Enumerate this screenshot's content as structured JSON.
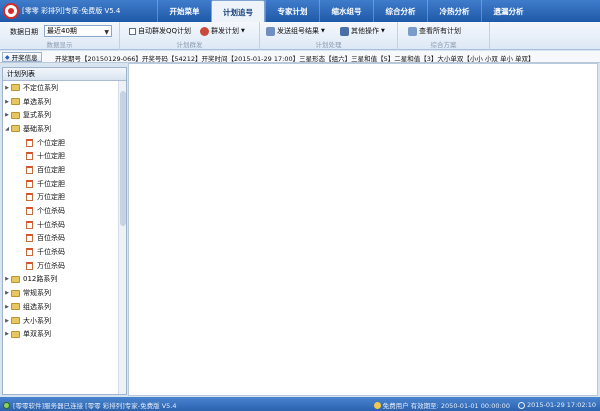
{
  "app": {
    "title": "[零零 彩排列]专家-免费版 V5.4"
  },
  "tabs": [
    {
      "label": "开始菜单",
      "active": false
    },
    {
      "label": "计划追号",
      "active": true
    },
    {
      "label": "专家计划",
      "active": false
    },
    {
      "label": "缩水组号",
      "active": false
    },
    {
      "label": "综合分析",
      "active": false
    },
    {
      "label": "冷热分析",
      "active": false
    },
    {
      "label": "遗漏分析",
      "active": false
    }
  ],
  "ribbon": {
    "data_label": "数据日期",
    "data_select_value": "最近40期",
    "group1_label": "数据显示",
    "auto_qq_label": "自动群发QQ计划",
    "qun_plan_label": "群发计划",
    "group2_label": "计划群发",
    "send_result_label": "发送组号结果",
    "other_ops_label": "其他操作",
    "group3_label": "计划处理",
    "view_all_label": "查看所有计划",
    "group4_label": "综合方案"
  },
  "infobar": {
    "button_label": "开奖信息",
    "text": "开奖期号【20150129-066】开奖号码【54212】开奖时间【2015-01-29 17:00】三星形态【组六】三星和值【5】二星和值【3】大小单双【小小 小双 单小 单双】"
  },
  "left_panel": {
    "title": "计划列表",
    "tree": [
      {
        "label": "不定位系列",
        "type": "folder",
        "expanded": false
      },
      {
        "label": "单选系列",
        "type": "folder",
        "expanded": false
      },
      {
        "label": "复式系列",
        "type": "folder",
        "expanded": false
      },
      {
        "label": "基础系列",
        "type": "folder",
        "expanded": true
      },
      {
        "label": "个位定胆",
        "type": "leaf"
      },
      {
        "label": "十位定胆",
        "type": "leaf"
      },
      {
        "label": "百位定胆",
        "type": "leaf"
      },
      {
        "label": "千位定胆",
        "type": "leaf"
      },
      {
        "label": "万位定胆",
        "type": "leaf"
      },
      {
        "label": "个位杀码",
        "type": "leaf"
      },
      {
        "label": "十位杀码",
        "type": "leaf"
      },
      {
        "label": "百位杀码",
        "type": "leaf"
      },
      {
        "label": "千位杀码",
        "type": "leaf"
      },
      {
        "label": "万位杀码",
        "type": "leaf"
      },
      {
        "label": "012路系列",
        "type": "folder",
        "expanded": false
      },
      {
        "label": "常规系列",
        "type": "folder",
        "expanded": false
      },
      {
        "label": "组选系列",
        "type": "folder",
        "expanded": false
      },
      {
        "label": "大小系列",
        "type": "folder",
        "expanded": false
      },
      {
        "label": "单双系列",
        "type": "folder",
        "expanded": false
      }
    ]
  },
  "statusbar": {
    "left_text": "[零零软件]服务器已连接  [零零 彩排列]专家-免费版 V5.4",
    "user_text": "免费用户 有效期至: 2050-01-01 00:00:00",
    "time_text": "2015-01-29 17:02:10"
  }
}
